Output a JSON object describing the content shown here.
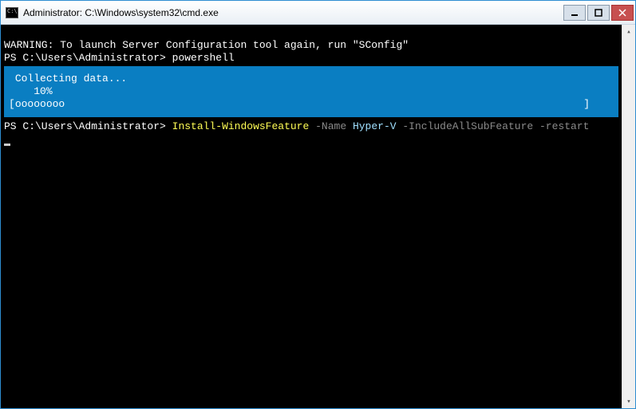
{
  "window": {
    "title": "Administrator: C:\\Windows\\system32\\cmd.exe"
  },
  "lines": {
    "warning": "WARNING: To launch Server Configuration tool again, run \"SConfig\"",
    "prompt1": "PS C:\\Users\\Administrator>",
    "cmd1": "powershell"
  },
  "progress": {
    "title": "Collecting data...",
    "percent": "10%",
    "bar_open": "[",
    "bar_fill": "oooooooo",
    "bar_close": "]"
  },
  "lines2": {
    "prompt2": "PS C:\\Users\\Administrator>",
    "cmdlet": "Install-WindowsFeature",
    "param1": "-Name",
    "arg1": "Hyper-V",
    "param2": "-IncludeAllSubFeature",
    "param3": "-restart"
  },
  "glyphs": {
    "up": "▴",
    "down": "▾"
  }
}
